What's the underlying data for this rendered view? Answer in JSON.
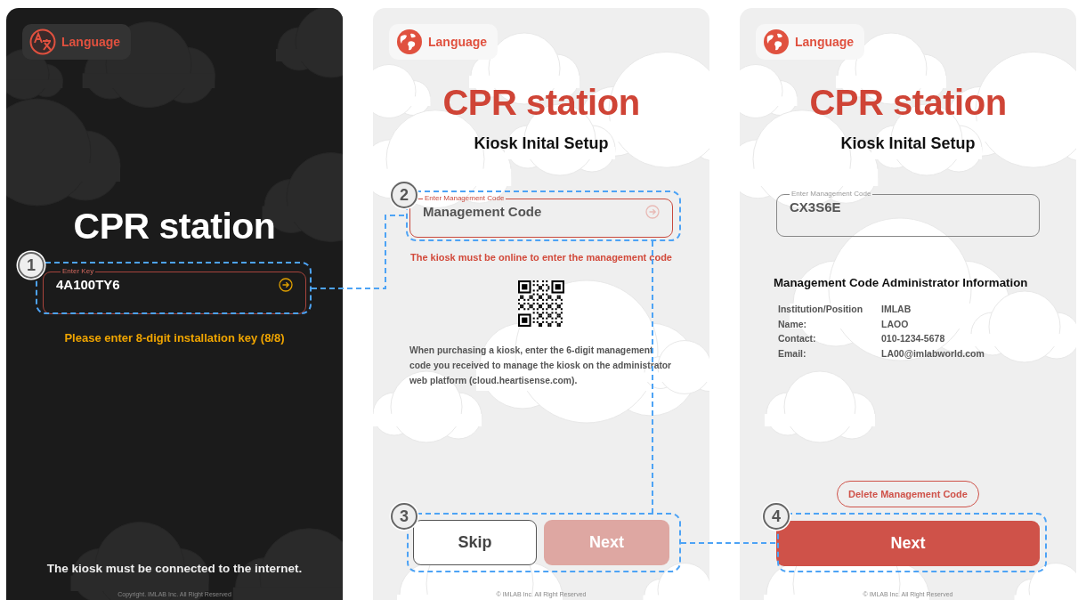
{
  "key_screen": {
    "language_button": "Language",
    "title": "CPR station",
    "key_field": {
      "label": "Enter Key",
      "value": "4A100TY6",
      "focused": true
    },
    "hint": "Please enter 8-digit installation key (8/8)",
    "notice": "The kiosk must be connected to the internet.",
    "footer": "Copyright. IMLAB Inc. All Right Reserved"
  },
  "code_screen": {
    "language_button": "Language",
    "title": "CPR station",
    "subtitle": "Kiosk Inital Setup",
    "code_field": {
      "label": "Enter Management Code",
      "placeholder": "Management Code",
      "focused": true
    },
    "warning": "The kiosk must be online to enter the management code",
    "description": "When purchasing a kiosk, enter the 6-digit management code you received to manage the kiosk on the administrator web platform (cloud.heartisense.com).",
    "skip_button": "Skip",
    "next_button": {
      "label": "Next",
      "disabled": true
    },
    "footer": "© IMLAB Inc. All Right Reserved"
  },
  "info_screen": {
    "language_button": "Language",
    "title": "CPR station",
    "subtitle": "Kiosk Inital Setup",
    "code_field": {
      "label": "Enter Management Code",
      "value": "CX3S6E",
      "focused": false
    },
    "info_heading": "Management Code Administrator Information",
    "info_rows": [
      {
        "label": "Institution/Position",
        "value": "IMLAB"
      },
      {
        "label": "Name:",
        "value": "LAOO"
      },
      {
        "label": "Contact:",
        "value": "010-1234-5678"
      },
      {
        "label": "Email:",
        "value": "LA00@imlabworld.com"
      }
    ],
    "delete_button": "Delete Management Code",
    "next_button": {
      "label": "Next",
      "disabled": false
    },
    "footer": "© IMLAB Inc. All Right Reserved"
  },
  "callouts": [
    {
      "number": "1"
    },
    {
      "number": "2"
    },
    {
      "number": "3"
    },
    {
      "number": "4"
    }
  ]
}
